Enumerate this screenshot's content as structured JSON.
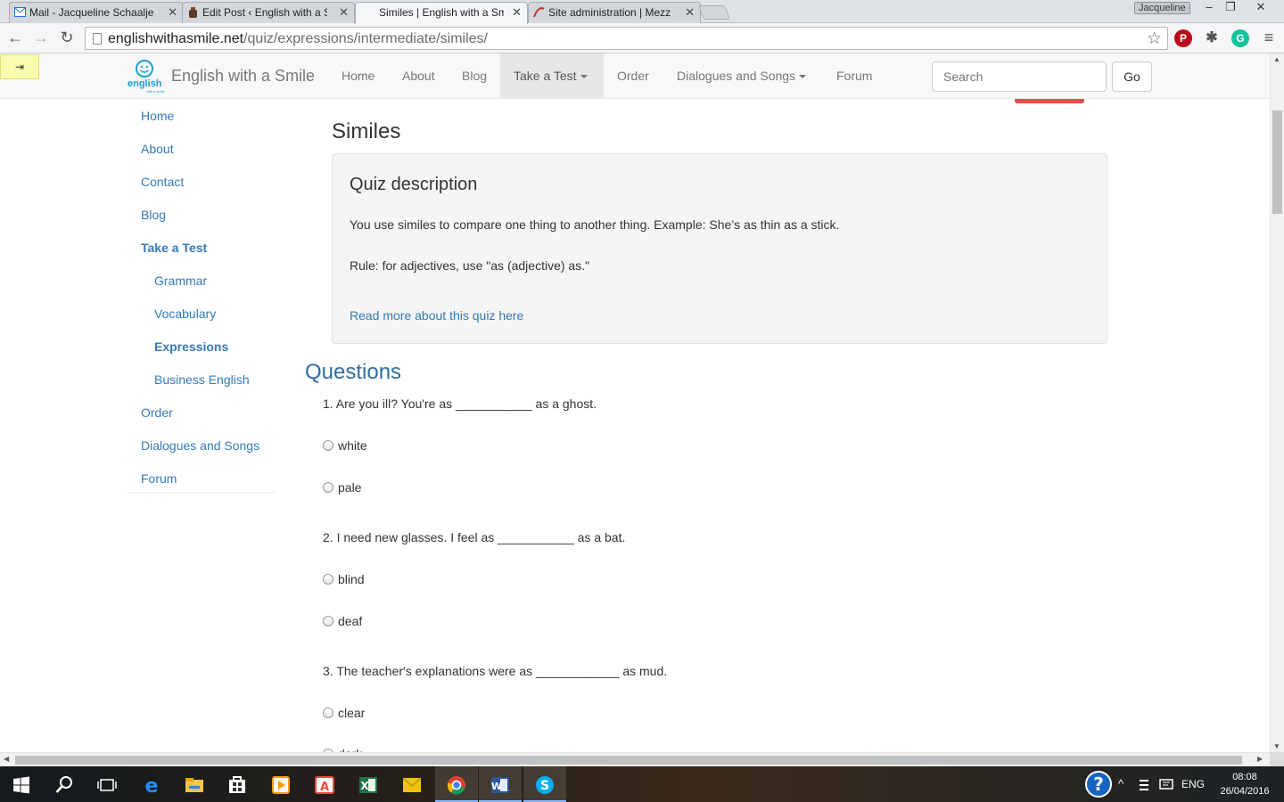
{
  "browser": {
    "tabs": [
      {
        "title": "Mail - Jacqueline Schaalje",
        "active": false
      },
      {
        "title": "Edit Post ‹ English with a S",
        "active": false
      },
      {
        "title": "Similes | English with a Sm",
        "active": true
      },
      {
        "title": "Site administration | Mezz",
        "active": false
      }
    ],
    "user_badge": "Jacqueline",
    "window_controls": {
      "minimize": "–",
      "restore": "❐",
      "close": "✕"
    },
    "url_host": "englishwithasmile.net",
    "url_path": "/quiz/expressions/intermediate/similes/",
    "nav": {
      "back": "←",
      "forward": "→",
      "reload": "↻",
      "star": "☆",
      "menu": "≡"
    },
    "extensions": [
      {
        "name": "pinterest-icon",
        "glyph": "P",
        "color": "#bd081c"
      },
      {
        "name": "puzzle-extension-icon",
        "glyph": "✱",
        "color": "#555555"
      },
      {
        "name": "grammarly-icon",
        "glyph": "G",
        "color": "#15c39a"
      }
    ]
  },
  "pinned_tab_glyph": "⇥",
  "site": {
    "logo_text": "english",
    "logo_sub": "with a smile",
    "brand": "English with a Smile",
    "nav": [
      {
        "label": "Home"
      },
      {
        "label": "About"
      },
      {
        "label": "Blog"
      },
      {
        "label": "Take a Test",
        "dropdown": true,
        "open": true
      },
      {
        "label": "Order"
      },
      {
        "label": "Dialogues and Songs",
        "dropdown": true
      },
      {
        "label": "Forum"
      }
    ],
    "search_placeholder": "Search",
    "search_button": "Go"
  },
  "sidebar": [
    {
      "label": "Home",
      "level": 0
    },
    {
      "label": "About",
      "level": 0
    },
    {
      "label": "Contact",
      "level": 0
    },
    {
      "label": "Blog",
      "level": 0
    },
    {
      "label": "Take a Test",
      "level": 0,
      "active": true
    },
    {
      "label": "Grammar",
      "level": 1
    },
    {
      "label": "Vocabulary",
      "level": 1
    },
    {
      "label": "Expressions",
      "level": 1,
      "active": true
    },
    {
      "label": "Business English",
      "level": 1
    },
    {
      "label": "Order",
      "level": 0
    },
    {
      "label": "Dialogues and Songs",
      "level": 0
    },
    {
      "label": "Forum",
      "level": 0
    }
  ],
  "content": {
    "title": "Similes",
    "description_heading": "Quiz description",
    "description_line1": "You use similes to compare one thing to another thing. Example: She’s as thin as a stick.",
    "description_line2": "Rule: for adjectives, use \"as (adjective) as.\"",
    "read_more": "Read more about this quiz here",
    "questions_heading": "Questions",
    "questions": [
      {
        "text": "1. Are you ill? You're as ___________ as a ghost.",
        "options": [
          "white",
          "pale"
        ]
      },
      {
        "text": "2. I need new glasses. I feel as ___________ as a bat.",
        "options": [
          "blind",
          "deaf"
        ]
      },
      {
        "text": "3. The teacher's explanations were as ____________ as mud.",
        "options": [
          "clear",
          "dark"
        ]
      }
    ]
  },
  "taskbar": {
    "apps": [
      {
        "name": "start-icon",
        "glyph": "⊞",
        "color": "#ffffff"
      },
      {
        "name": "search-icon",
        "glyph": "⌕",
        "color": "#ffffff"
      },
      {
        "name": "task-view-icon",
        "glyph": "❐",
        "color": "#ffffff"
      },
      {
        "name": "edge-icon",
        "glyph": "e",
        "color": "#1e90ff"
      },
      {
        "name": "file-explorer-icon",
        "glyph": "▬",
        "color": "#f4c542"
      },
      {
        "name": "store-icon",
        "glyph": "◫",
        "color": "#ffffff"
      },
      {
        "name": "media-player-icon",
        "glyph": "▶",
        "color": "#f39c12"
      },
      {
        "name": "acrobat-icon",
        "glyph": "A",
        "color": "#e74c3c"
      },
      {
        "name": "excel-icon",
        "glyph": "X",
        "color": "#217346"
      },
      {
        "name": "notes-icon",
        "glyph": "✉",
        "color": "#f1c40f"
      },
      {
        "name": "chrome-icon",
        "glyph": "◉",
        "color": "#4caf50",
        "running": true
      },
      {
        "name": "word-icon",
        "glyph": "W",
        "color": "#2b579a",
        "running": true
      },
      {
        "name": "skype-icon",
        "glyph": "S",
        "color": "#00aff0",
        "running": true
      }
    ],
    "tray": {
      "help_glyph": "?",
      "chevron": "^",
      "language": "ENG",
      "time": "08:08",
      "date": "26/04/2016"
    }
  }
}
